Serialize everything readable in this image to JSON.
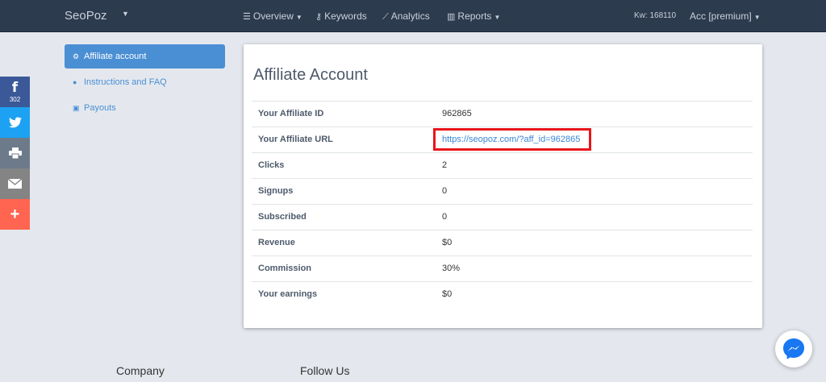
{
  "navbar": {
    "brand": "SeoPoz",
    "items": [
      {
        "icon": "menu-icon",
        "label": "Overview",
        "dropdown": true
      },
      {
        "icon": "key-icon",
        "label": "Keywords",
        "dropdown": false
      },
      {
        "icon": "chart-line-icon",
        "label": "Analytics",
        "dropdown": false
      },
      {
        "icon": "chart-bar-icon",
        "label": "Reports",
        "dropdown": true
      }
    ],
    "kw": "Kw: 168110",
    "account": "Acc [premium]"
  },
  "share": {
    "facebook_count": "302",
    "colors": {
      "facebook": "#3b5998",
      "twitter": "#1da1f2",
      "print": "#6d7a8a",
      "email": "#848484",
      "more": "#ff6550"
    }
  },
  "sidebar": {
    "items": [
      {
        "icon": "gear-icon",
        "label": "Affiliate account",
        "active": true
      },
      {
        "icon": "question-circle-icon",
        "label": "Instructions and FAQ",
        "active": false
      },
      {
        "icon": "money-icon",
        "label": "Payouts",
        "active": false
      }
    ]
  },
  "panel": {
    "title": "Affiliate Account",
    "rows": [
      {
        "label": "Your Affiliate ID",
        "value": "962865"
      },
      {
        "label": "Your Affiliate URL",
        "value": "https://seopoz.com/?aff_id=962865",
        "link": true,
        "highlighted": true
      },
      {
        "label": "Clicks",
        "value": "2"
      },
      {
        "label": "Signups",
        "value": "0"
      },
      {
        "label": "Subscribed",
        "value": "0"
      },
      {
        "label": "Revenue",
        "value": "$0"
      },
      {
        "label": "Commission",
        "value": "30%"
      },
      {
        "label": "Your earnings",
        "value": "$0"
      }
    ]
  },
  "footer": {
    "company": "Company",
    "follow": "Follow Us"
  },
  "colors": {
    "accent": "#4a8fd4",
    "highlight": "#e8161b",
    "navbar": "#2d3b4f"
  }
}
